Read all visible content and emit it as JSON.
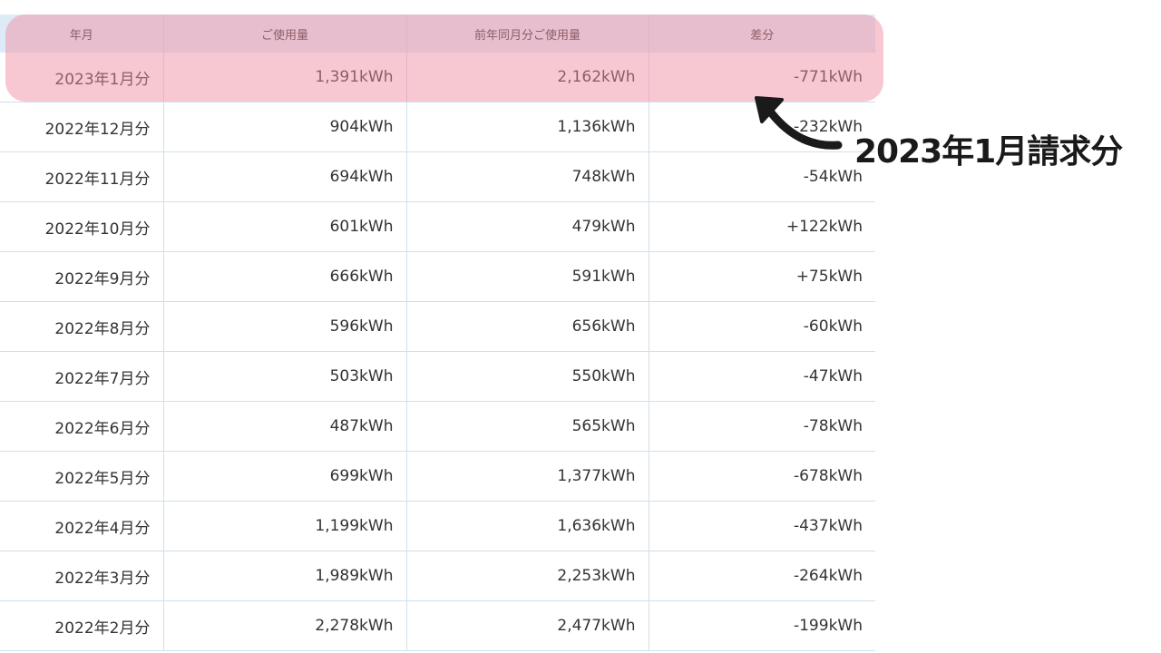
{
  "table": {
    "headers": [
      "年月",
      "ご使用量",
      "前年同月分ご使用量",
      "差分"
    ],
    "rows": [
      [
        "2023年1月分",
        "1,391kWh",
        "2,162kWh",
        "-771kWh"
      ],
      [
        "2022年12月分",
        "904kWh",
        "1,136kWh",
        "-232kWh"
      ],
      [
        "2022年11月分",
        "694kWh",
        "748kWh",
        "-54kWh"
      ],
      [
        "2022年10月分",
        "601kWh",
        "479kWh",
        "+122kWh"
      ],
      [
        "2022年9月分",
        "666kWh",
        "591kWh",
        "+75kWh"
      ],
      [
        "2022年8月分",
        "596kWh",
        "656kWh",
        "-60kWh"
      ],
      [
        "2022年7月分",
        "503kWh",
        "550kWh",
        "-47kWh"
      ],
      [
        "2022年6月分",
        "487kWh",
        "565kWh",
        "-78kWh"
      ],
      [
        "2022年5月分",
        "699kWh",
        "1,377kWh",
        "-678kWh"
      ],
      [
        "2022年4月分",
        "1,199kWh",
        "1,636kWh",
        "-437kWh"
      ],
      [
        "2022年3月分",
        "1,989kWh",
        "2,253kWh",
        "-264kWh"
      ],
      [
        "2022年2月分",
        "2,278kWh",
        "2,477kWh",
        "-199kWh"
      ]
    ]
  },
  "annotation": {
    "label": "2023年1月請求分"
  },
  "colors": {
    "header_bg": "#dcebf7",
    "highlight": "#f08ca0",
    "text": "#333333",
    "annotation_text": "#1a1a1a"
  }
}
